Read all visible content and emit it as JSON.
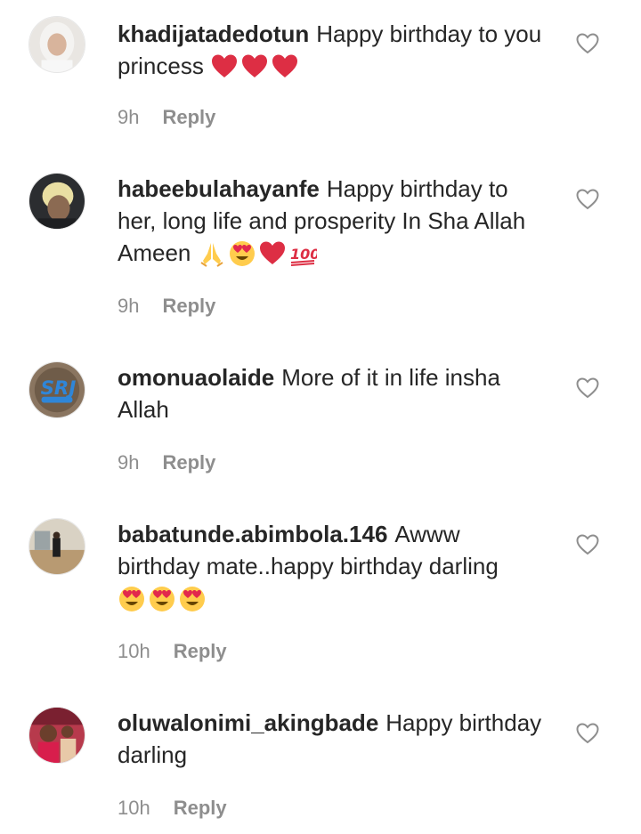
{
  "colors": {
    "text": "#262626",
    "meta": "#8e8e8e",
    "heart_red": "#dd2e44"
  },
  "comments": [
    {
      "username": "khadijatadedotun",
      "text": "Happy birthday to you princess",
      "emojis": [
        "red-heart",
        "red-heart",
        "red-heart"
      ],
      "time": "9h",
      "reply_label": "Reply"
    },
    {
      "username": "habeebulahayanfe",
      "text": "Happy birthday to her, long life and prosperity In Sha Allah Ameen",
      "emojis": [
        "folded-hands",
        "heart-eyes",
        "red-heart",
        "hundred-points"
      ],
      "time": "9h",
      "reply_label": "Reply"
    },
    {
      "username": "omonuaolaide",
      "text": "More of it in life insha Allah",
      "emojis": [],
      "time": "9h",
      "reply_label": "Reply"
    },
    {
      "username": "babatunde.abimbola.146",
      "text": "Awww birthday mate..happy birthday darling",
      "emojis": [
        "heart-eyes",
        "heart-eyes",
        "heart-eyes"
      ],
      "time": "10h",
      "reply_label": "Reply"
    },
    {
      "username": "oluwalonimi_akingbade",
      "text": "Happy birthday darling",
      "emojis": [],
      "time": "10h",
      "reply_label": "Reply"
    }
  ]
}
